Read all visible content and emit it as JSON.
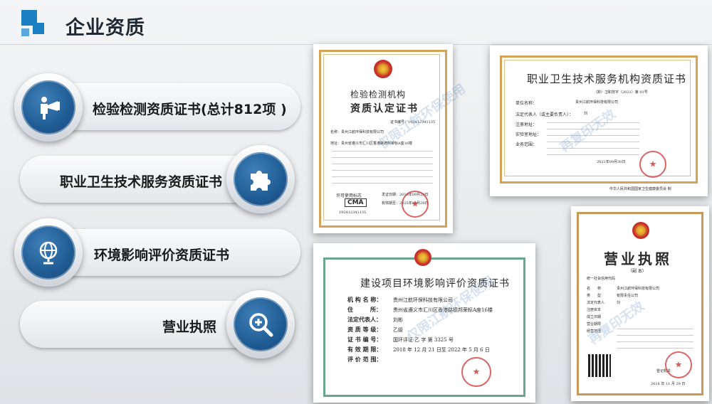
{
  "header": {
    "title": "企业资质"
  },
  "menu": [
    {
      "label": "检验检测资质证书(总计812项 )",
      "icon": "person-presentation-icon"
    },
    {
      "label": "职业卫生技术服务资质证书",
      "icon": "puzzle-icon"
    },
    {
      "label": "环境影响评价资质证书",
      "icon": "globe-icon"
    },
    {
      "label": "营业执照",
      "icon": "magnify-plus-icon"
    }
  ],
  "cert_inspection": {
    "title1": "检验检测机构",
    "title2": "资质认定证书",
    "number": "证书编号：192412341135",
    "org_line": "名称：贵州江航环保科技有限公司",
    "addr_line": "地址：贵州省遵义市汇川区香港路德邦荣标A座16楼",
    "cma": "CMA",
    "cma_num": "192412341135",
    "issue": "发证日期：2019年09月29日",
    "valid": "有效期至：2025年09月28日",
    "org_label": "许可使用标志"
  },
  "cert_occupational": {
    "title": "职业卫生技术服务机构资质证书",
    "number": "（黔）卫职技字（2021）第 01号",
    "rows": [
      {
        "k": "单位名称：",
        "v": "贵州江航环保科技有限公司"
      },
      {
        "k": "法定代表人（或主要负责人）：",
        "v": "刘"
      },
      {
        "k": "注册地址：",
        "v": ""
      },
      {
        "k": "实验室地址：",
        "v": ""
      },
      {
        "k": "业务范围：",
        "v": ""
      }
    ],
    "date": "2021年09月30日",
    "issuer": "中华人民共和国国家卫生健康委员会 制"
  },
  "cert_env": {
    "title": "建设项目环境影响评价资质证书",
    "rows": [
      {
        "k": "机 构 名 称：",
        "v": "贵州江航环保科技有限公司"
      },
      {
        "k": "住　　　所：",
        "v": "贵州省遵义市汇川区香港路德邦荣标A座16楼"
      },
      {
        "k": "法定代表人：",
        "v": "刘彬"
      },
      {
        "k": "资 质 等 级：",
        "v": "乙级"
      },
      {
        "k": "证 书 编 号：",
        "v": "国环评证  乙 字 第  3325  号"
      },
      {
        "k": "有 效 期 限：",
        "v": "2018 年 12 月 21 日至 2022 年 5 月 6 日"
      },
      {
        "k": "评 价 范 围：",
        "v": ""
      }
    ]
  },
  "cert_license": {
    "title": "营业执照",
    "sub": "（副 本）",
    "credit": "统一社会信用代码",
    "rows": [
      {
        "k": "名　　称",
        "v": "贵州江航环保科技有限公司"
      },
      {
        "k": "类　　型",
        "v": "有限责任公司"
      },
      {
        "k": "法定代表人",
        "v": "刘"
      },
      {
        "k": "注册资本",
        "v": ""
      },
      {
        "k": "成立日期",
        "v": ""
      },
      {
        "k": "营业期限",
        "v": ""
      },
      {
        "k": "经营范围",
        "v": ""
      }
    ],
    "date": "2018 年 11 月 29 日",
    "reg": "登记机关"
  },
  "watermark": {
    "text": "仅限江航环保使用",
    "text2": "再复印无效"
  }
}
